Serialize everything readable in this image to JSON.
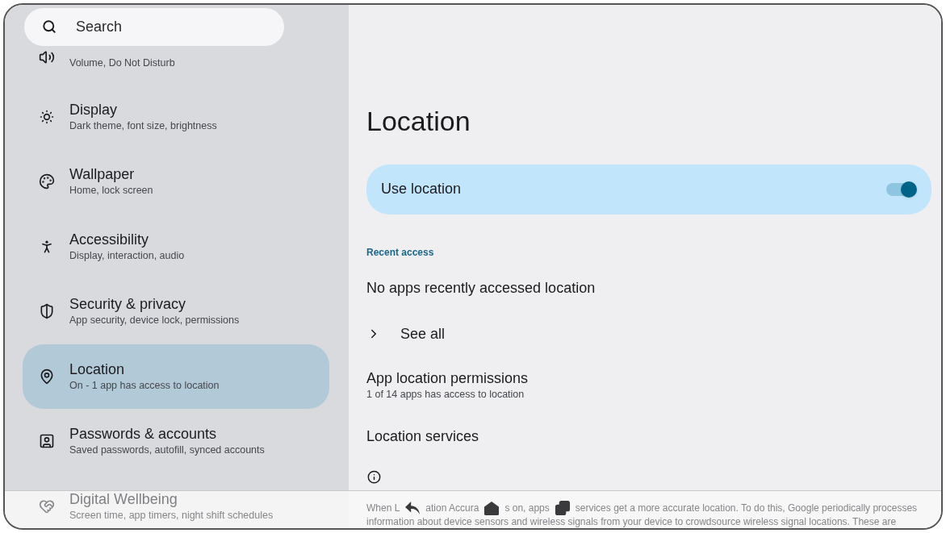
{
  "search": {
    "placeholder": "Search"
  },
  "sidebar": {
    "items": [
      {
        "subtitle": "Volume, Do Not Disturb",
        "selected": false
      },
      {
        "title": "Display",
        "subtitle": "Dark theme, font size, brightness",
        "selected": false
      },
      {
        "title": "Wallpaper",
        "subtitle": "Home, lock screen",
        "selected": false
      },
      {
        "title": "Accessibility",
        "subtitle": "Display, interaction, audio",
        "selected": false
      },
      {
        "title": "Security & privacy",
        "subtitle": "App security, device lock, permissions",
        "selected": false
      },
      {
        "title": "Location",
        "subtitle": "On - 1 app has access to location",
        "selected": true
      },
      {
        "title": "Passwords & accounts",
        "subtitle": "Saved passwords, autofill, synced accounts",
        "selected": false
      },
      {
        "title": "Digital Wellbeing",
        "subtitle": "Screen time, app timers, night shift schedules",
        "selected": false
      }
    ]
  },
  "page": {
    "title": "Location",
    "main_switch": {
      "label": "Use location",
      "on": true
    },
    "section_header": "Recent access",
    "recent_text": "No apps recently accessed location",
    "see_all": "See all",
    "app_permissions": {
      "title": "App location permissions",
      "subtitle": "1 of 14 apps has access to location"
    },
    "location_services": "Location services",
    "footer_first_line": [
      "When L",
      "ation Accura",
      "s on, apps",
      "services get a more accurate location. To do this, Google periodically processes"
    ],
    "footer_lines": [
      "information about device sensors and wireless signals from your device to crowdsource wireless signal locations. These are"
    ]
  }
}
